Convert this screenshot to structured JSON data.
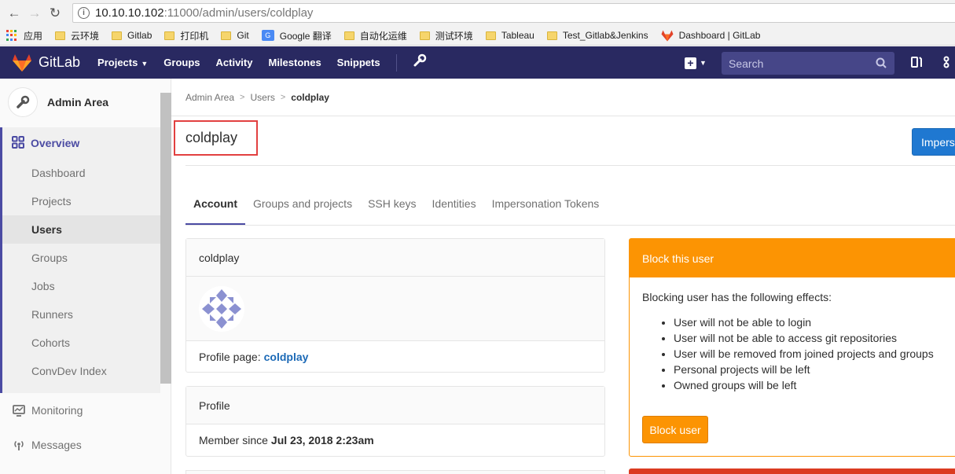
{
  "browser": {
    "url_host": "10.10.10.102",
    "url_path": ":11000/admin/users/coldplay",
    "bookmarks": [
      {
        "label": "应用",
        "icon": "apps-icon"
      },
      {
        "label": "云环境",
        "icon": "folder-icon"
      },
      {
        "label": "Gitlab",
        "icon": "folder-icon"
      },
      {
        "label": "打印机",
        "icon": "folder-icon"
      },
      {
        "label": "Git",
        "icon": "folder-icon"
      },
      {
        "label": "Google 翻译",
        "icon": "google-translate-icon"
      },
      {
        "label": "自动化运维",
        "icon": "folder-icon"
      },
      {
        "label": "测试环境",
        "icon": "folder-icon"
      },
      {
        "label": "Tableau",
        "icon": "folder-icon"
      },
      {
        "label": "Test_Gitlab&Jenkins",
        "icon": "folder-icon"
      },
      {
        "label": "Dashboard | GitLab",
        "icon": "gitlab-icon"
      }
    ]
  },
  "header": {
    "brand": "GitLab",
    "nav": {
      "projects": "Projects",
      "groups": "Groups",
      "activity": "Activity",
      "milestones": "Milestones",
      "snippets": "Snippets"
    },
    "search_placeholder": "Search",
    "colors": {
      "bg": "#292961",
      "search_bg": "#464688"
    }
  },
  "sidebar": {
    "title": "Admin Area",
    "overview": "Overview",
    "sub_items": [
      "Dashboard",
      "Projects",
      "Users",
      "Groups",
      "Jobs",
      "Runners",
      "Cohorts",
      "ConvDev Index"
    ],
    "active_item": "Users",
    "monitoring": "Monitoring",
    "messages": "Messages"
  },
  "breadcrumb": {
    "admin_area": "Admin Area",
    "users": "Users",
    "current": "coldplay"
  },
  "page": {
    "title": "coldplay",
    "impersonate_label": "Imperso"
  },
  "tabs": {
    "account": "Account",
    "groups_projects": "Groups and projects",
    "ssh_keys": "SSH keys",
    "identities": "Identities",
    "tokens": "Impersonation Tokens"
  },
  "account_panel": {
    "username": "coldplay",
    "profile_label": "Profile page:",
    "profile_link": "coldplay"
  },
  "profile_panel": {
    "title": "Profile",
    "member_since_label": "Member since",
    "member_since_value": "Jul 23, 2018 2:23am"
  },
  "block_panel": {
    "title": "Block this user",
    "intro": "Blocking user has the following effects:",
    "effects": [
      "User will not be able to login",
      "User will not be able to access git repositories",
      "User will be removed from joined projects and groups",
      "Personal projects will be left",
      "Owned groups will be left"
    ],
    "button": "Block user",
    "color": "#fc9403"
  }
}
